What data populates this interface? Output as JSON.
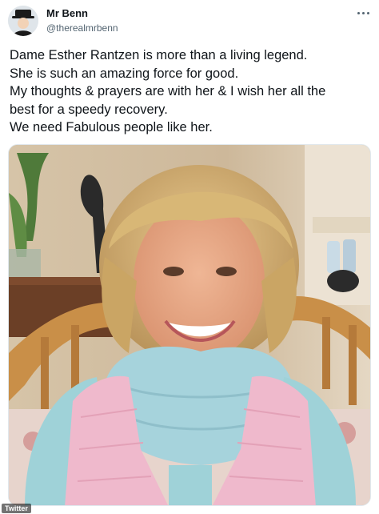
{
  "tweet": {
    "author": {
      "display_name": "Mr Benn",
      "handle": "@therealmrbenn",
      "avatar_icon": "avatar-icon"
    },
    "more_icon": "more-options-icon",
    "lines": [
      "Dame Esther Rantzen is more than a living legend.",
      "She is such an amazing force for good.",
      "My thoughts & prayers are with her & I wish her all the",
      "best for a speedy recovery.",
      "We need Fabulous people like her."
    ]
  },
  "watermark": "Twitter",
  "colors": {
    "text": "#0f1419",
    "secondary": "#536471",
    "scarf": "#a6d3dc",
    "vest": "#efb9cc"
  }
}
